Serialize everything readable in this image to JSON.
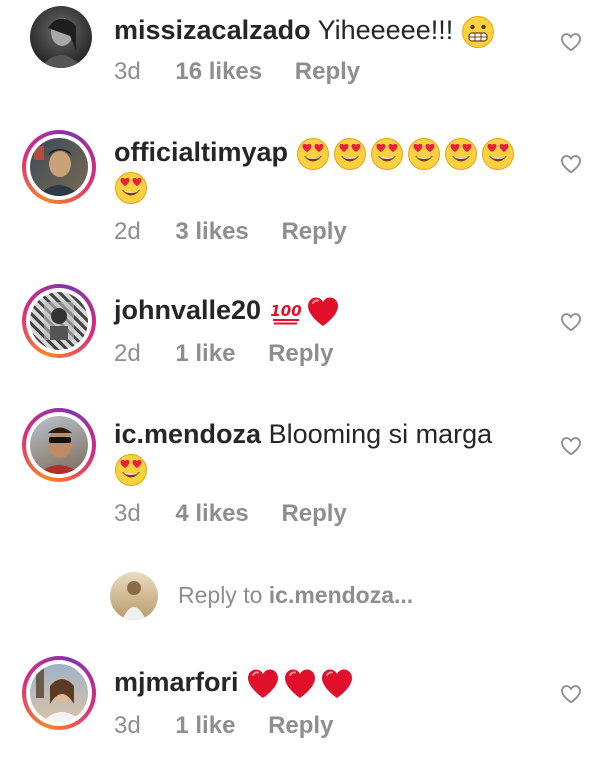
{
  "comments": [
    {
      "username": "missizacalzado",
      "text": "Yiheeeee!!!",
      "emoji": [
        "grimace"
      ],
      "age": "3d",
      "likes": "16 likes",
      "reply": "Reply",
      "story_ring": false
    },
    {
      "username": "officialtimyap",
      "text": "",
      "emoji": [
        "heart-eyes",
        "heart-eyes",
        "heart-eyes",
        "heart-eyes",
        "heart-eyes",
        "heart-eyes",
        "heart-eyes"
      ],
      "age": "2d",
      "likes": "3 likes",
      "reply": "Reply",
      "story_ring": true
    },
    {
      "username": "johnvalle20",
      "text": "",
      "emoji": [
        "hundred",
        "red-heart"
      ],
      "age": "2d",
      "likes": "1 like",
      "reply": "Reply",
      "story_ring": true
    },
    {
      "username": "ic.mendoza",
      "text": "Blooming si marga",
      "emoji": [
        "heart-eyes"
      ],
      "age": "3d",
      "likes": "4 likes",
      "reply": "Reply",
      "story_ring": true
    },
    {
      "username": "mjmarfori",
      "text": "",
      "emoji": [
        "red-heart",
        "red-heart",
        "red-heart"
      ],
      "age": "3d",
      "likes": "1 like",
      "reply": "Reply",
      "story_ring": true
    }
  ],
  "reply_box": {
    "prefix": "Reply to",
    "target": "ic.mendoza..."
  },
  "colors": {
    "text": "#262626",
    "secondary": "#8e8e8e",
    "ring_start": "#f58529",
    "ring_mid": "#dd2a7b",
    "ring_end": "#8134af"
  }
}
